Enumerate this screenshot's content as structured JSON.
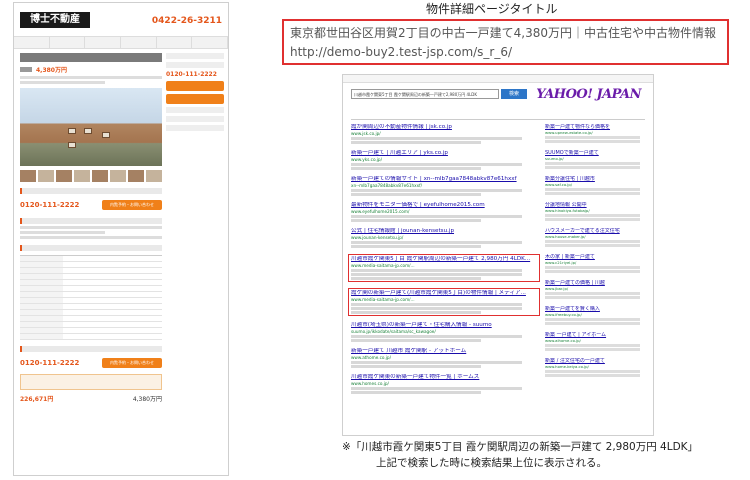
{
  "left_page": {
    "logo": "博士不動産",
    "phone": "0422-26-3211",
    "price": "4,380万円",
    "contact_phone": "0120-111-2222",
    "inquiry_button": "内覧予約・お問い合わせ",
    "loan_total": "226,671円",
    "loan_price": "4,380万円"
  },
  "caption": "物件詳細ページタイトル",
  "title_box": {
    "line1": "東京都世田谷区用賀2丁目の中古一戸建て4,380万円｜中古住宅や中古物件情報｜",
    "line2": "http://demo-buy2.test-jsp.com/s_r_6/"
  },
  "serp": {
    "search_query": "川越市霞ケ関東5丁目 霞ケ関駅周辺の新築一戸建て2,980万円 4LDK",
    "search_button": "検索",
    "logo": "YAHOO! JAPAN",
    "results": [
      {
        "title": "霞が関周辺の不動産物件情報 | jsk.co.jp",
        "url": "www.jsk.co.jp/"
      },
      {
        "title": "新築一戸建て | 川越エリア | yks.co.jp",
        "url": "www.yks.co.jp/"
      },
      {
        "title": "新築一戸建ての情報サイト | xn--mlb7gaa7848abkv87e61hxxf",
        "url": "xn--mlb7gaa7848abkv87e61hxxf/"
      },
      {
        "title": "最新物件をモニター価格で | eyefulhome2015.com",
        "url": "www.eyefulhome2015.com/"
      },
      {
        "title": "公式 | 住宅情報館 | jounan-kensetsu.jp",
        "url": "www.jounan-kensetsu.jp/"
      },
      {
        "title": "川越市霞ケ関東5丁目 霞ケ関駅周辺の新築一戸建て 2,980万円 4LDK...",
        "url": "www.media-saitama-jp.com/..."
      },
      {
        "title": "霞ケ関の新築一戸建て(川越市霞ケ関東5丁目)の物件情報 | メディア...",
        "url": "www.media-saitama-jp.com/..."
      },
      {
        "title": "川越市(埼玉県)の新築一戸建て・住宅購入情報 - suumo",
        "url": "suumo.jp/ikkodate/saitama/sc_kawagoe/"
      },
      {
        "title": "新築一戸建て 川越市 霞ケ関駅 - アットホーム",
        "url": "www.athome.co.jp/"
      },
      {
        "title": "川越市霞ケ関東の新築一戸建て物件一覧 | ホームズ",
        "url": "www.homes.co.jp/"
      }
    ],
    "ads": [
      {
        "title": "新築一戸建て物件なら価格を",
        "url": "www.upnew-estate.co.jp/"
      },
      {
        "title": "SUUMOで新築一戸建て",
        "url": "suumo.jp/"
      },
      {
        "title": "新築分譲住宅 | 川越市",
        "url": "www.saf.co.jp/"
      },
      {
        "title": "分譲地情報 公開中",
        "url": "www.hinokiya-futabajp/"
      },
      {
        "title": "ハウスメーカーで建てる注文住宅",
        "url": "www.house-maker.jp/"
      },
      {
        "title": "木の家 | 新築一戸建て",
        "url": "www.c21riyel.jp/"
      },
      {
        "title": "新築一戸建ての価格 | 川越",
        "url": "www.jbar.jp/"
      },
      {
        "title": "新築一戸建てを賢く購入",
        "url": "www.ifreebuy.co.jp/"
      },
      {
        "title": "新築 一戸建て | アイホーム",
        "url": "www.aihome.co.jp/"
      },
      {
        "title": "新築 / 注文住宅の一戸建て",
        "url": "www.home-keiya.co.jp/"
      }
    ]
  },
  "footnote": {
    "line1": "※「川越市霞ケ関東5丁目 霞ケ関駅周辺の新築一戸建て 2,980万円 4LDK」",
    "line2": "上記で検索した時に検索結果上位に表示される。"
  }
}
